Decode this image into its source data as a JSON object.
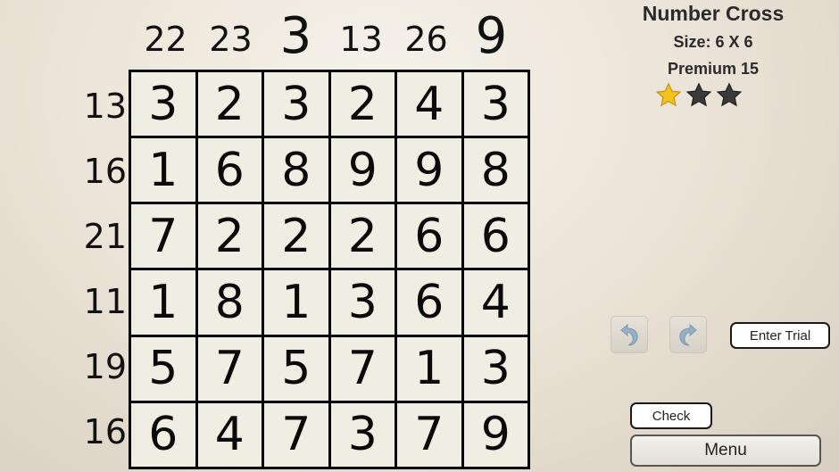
{
  "puzzle": {
    "title": "Number Cross",
    "size_text": "Size: 6 X 6",
    "level_text": "Premium 15",
    "stars": {
      "earned": 1,
      "total": 3
    },
    "column_clues": [
      "22",
      "23",
      "3",
      "13",
      "26",
      "9"
    ],
    "row_clues": [
      "13",
      "16",
      "21",
      "11",
      "19",
      "16"
    ],
    "grid": [
      [
        "3",
        "2",
        "3",
        "2",
        "4",
        "3"
      ],
      [
        "1",
        "6",
        "8",
        "9",
        "9",
        "8"
      ],
      [
        "7",
        "2",
        "2",
        "2",
        "6",
        "6"
      ],
      [
        "1",
        "8",
        "1",
        "3",
        "6",
        "4"
      ],
      [
        "5",
        "7",
        "5",
        "7",
        "1",
        "3"
      ],
      [
        "6",
        "4",
        "7",
        "3",
        "7",
        "9"
      ]
    ]
  },
  "controls": {
    "undo_icon": "undo-arrow-icon",
    "redo_icon": "redo-arrow-icon",
    "enter_trial_label": "Enter Trial",
    "check_label": "Check",
    "menu_label": "Menu"
  },
  "colors": {
    "star_filled": "#f2c21b",
    "star_empty": "#3a3a3a",
    "grid_line": "#000000",
    "cell_bg": "#f0eee3",
    "arrow_blue": "#7aa2c4"
  }
}
